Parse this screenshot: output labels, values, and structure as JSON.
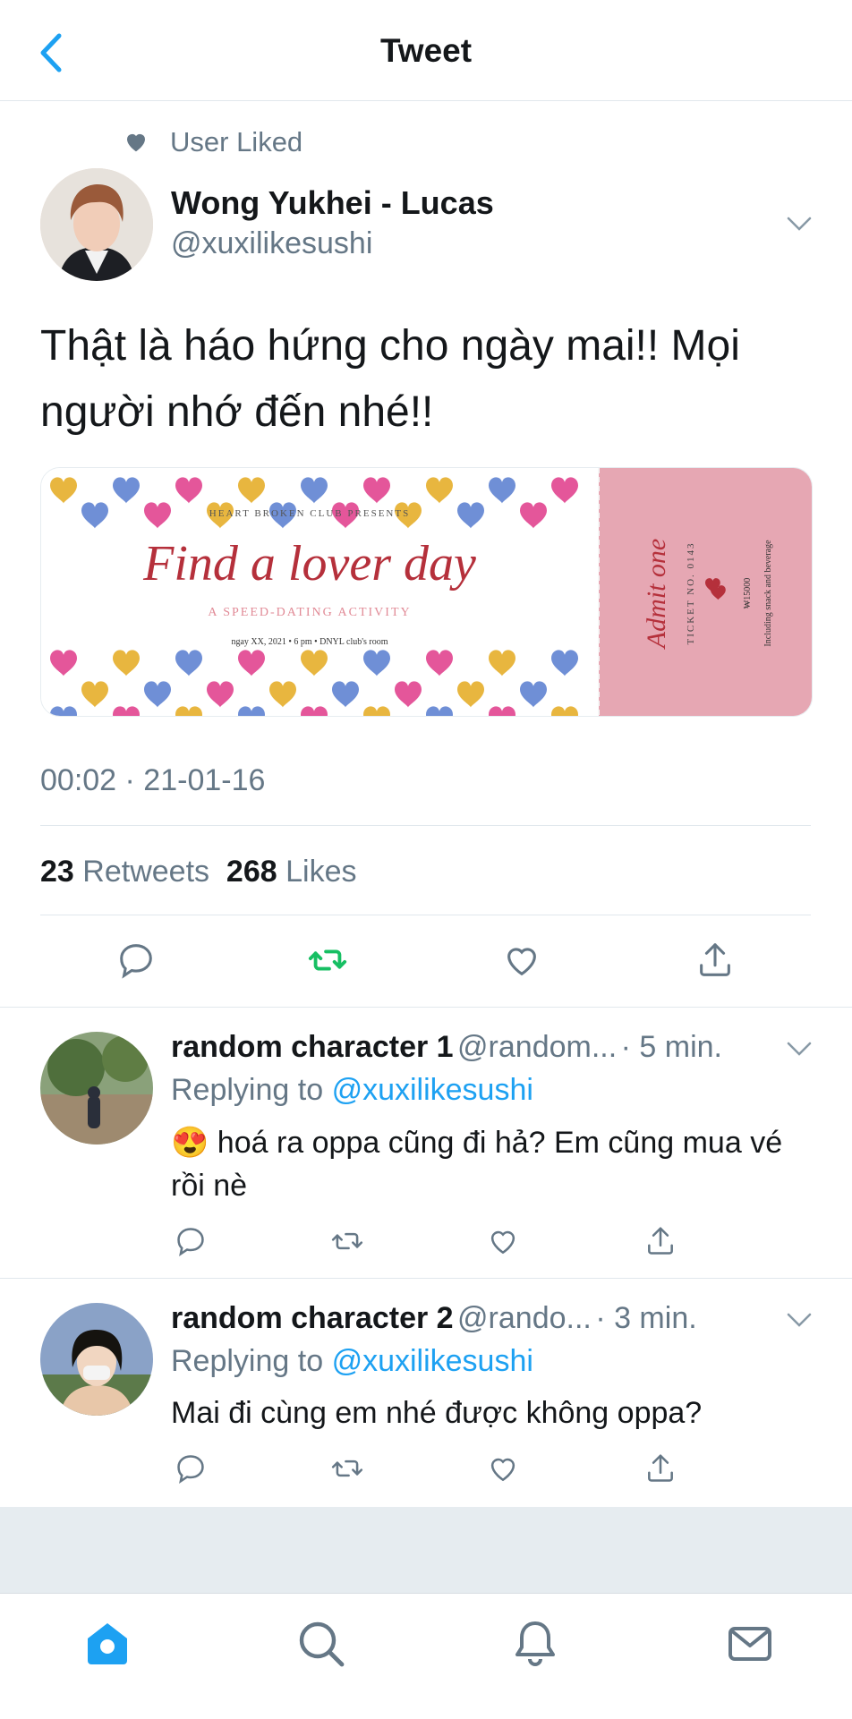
{
  "header": {
    "title": "Tweet"
  },
  "social_context": {
    "text": "User Liked"
  },
  "tweet": {
    "author_name": "Wong Yukhei - Lucas",
    "author_handle": "@xuxilikesushi",
    "text": "Thật là háo hứng cho ngày mai!! Mọi người nhớ đến nhé!!",
    "timestamp": "00:02 · 21-01-16",
    "retweets_count": "23",
    "retweets_label": "Retweets",
    "likes_count": "268",
    "likes_label": "Likes"
  },
  "ticket": {
    "presenter": "HEART BROKEN CLUB PRESENTS",
    "title": "Find a lover day",
    "subtitle": "A SPEED-DATING ACTIVITY",
    "details": "ngay XX, 2021 • 6 pm • DNYL club's room",
    "stub_admit": "Admit one",
    "stub_ticket_no": "TICKET NO. 0143",
    "stub_price": "₩15000",
    "stub_note": "Including snack and beverage"
  },
  "replies": [
    {
      "name": "random character 1",
      "handle": "@random...",
      "time": "· 5 min.",
      "replying_prefix": "Replying to",
      "replying_handle": "@xuxilikesushi",
      "emoji": "😍",
      "text": "hoá ra oppa cũng đi hả? Em cũng mua vé rồi nè"
    },
    {
      "name": "random character 2",
      "handle": "@rando...",
      "time": "· 3 min.",
      "replying_prefix": "Replying to",
      "replying_handle": "@xuxilikesushi",
      "text": "Mai đi cùng em nhé được không oppa?"
    }
  ],
  "colors": {
    "accent": "#1da1f2",
    "retweet_green": "#17bf63",
    "secondary_text": "#657786",
    "ticket_stub": "#e6a7b3",
    "ticket_title": "#b5303b"
  },
  "icons": {
    "back": "chevron-left-icon",
    "liked": "heart-filled-icon",
    "tabs": [
      "home-icon",
      "search-icon",
      "bell-icon",
      "mail-icon"
    ]
  }
}
